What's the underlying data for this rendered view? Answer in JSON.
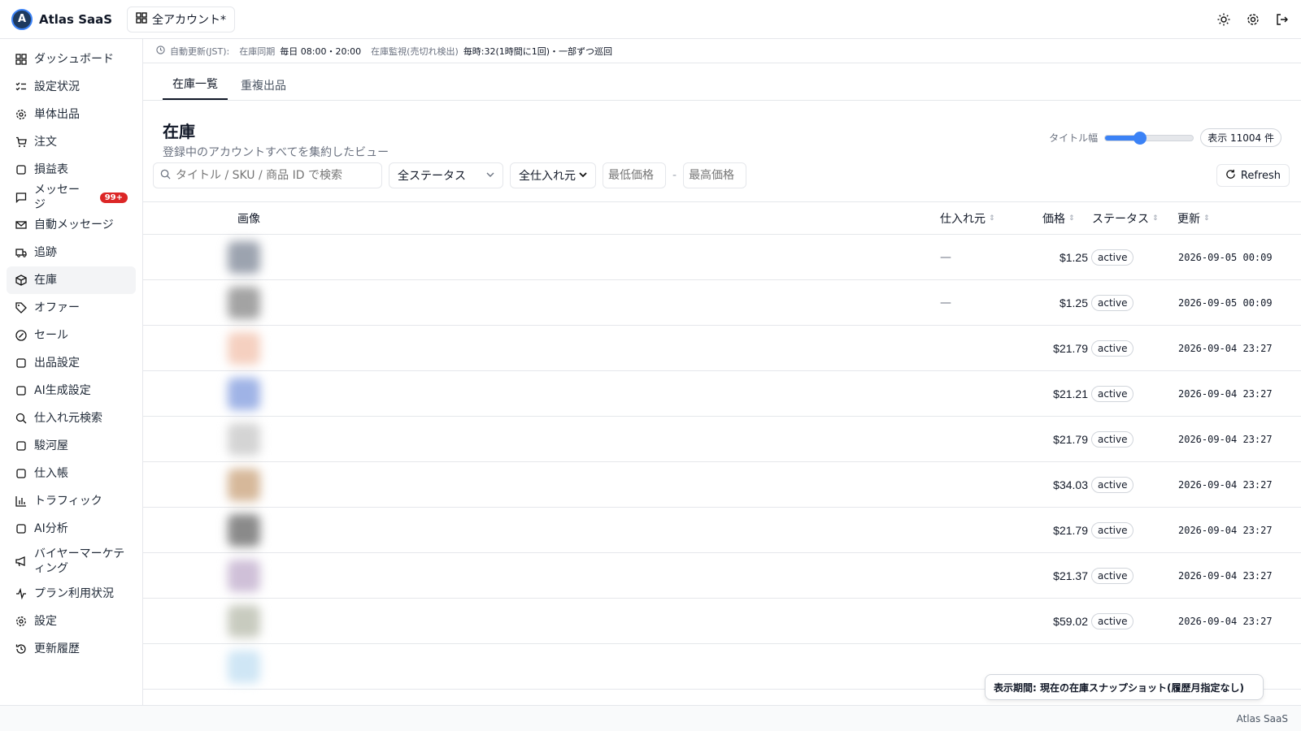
{
  "header": {
    "brand": "Atlas SaaS",
    "logo_letter": "A",
    "account_label": "全アカウント*"
  },
  "sidebar": {
    "items": [
      {
        "label": "ダッシュボード",
        "icon": "dashboard-icon"
      },
      {
        "label": "設定状況",
        "icon": "checklist-icon"
      },
      {
        "label": "単体出品",
        "icon": "gear-icon"
      },
      {
        "label": "注文",
        "icon": "cart-icon"
      },
      {
        "label": "損益表",
        "icon": "report-icon"
      },
      {
        "label": "メッセージ",
        "icon": "message-icon",
        "badge": "99+"
      },
      {
        "label": "自動メッセージ",
        "icon": "mail-icon"
      },
      {
        "label": "追跡",
        "icon": "truck-icon"
      },
      {
        "label": "在庫",
        "icon": "box-icon",
        "active": true
      },
      {
        "label": "オファー",
        "icon": "tag-icon"
      },
      {
        "label": "セール",
        "icon": "percent-icon"
      },
      {
        "label": "出品設定",
        "icon": "calculator-icon"
      },
      {
        "label": "AI生成設定",
        "icon": "robot-icon"
      },
      {
        "label": "仕入れ元検索",
        "icon": "search-icon"
      },
      {
        "label": "駿河屋",
        "icon": "bag-icon"
      },
      {
        "label": "仕入帳",
        "icon": "clipboard-icon"
      },
      {
        "label": "トラフィック",
        "icon": "bar-chart-icon"
      },
      {
        "label": "AI分析",
        "icon": "brain-icon"
      },
      {
        "label": "バイヤーマーケティング",
        "icon": "megaphone-icon"
      },
      {
        "label": "プラン利用状況",
        "icon": "activity-icon"
      },
      {
        "label": "設定",
        "icon": "settings-icon"
      },
      {
        "label": "更新履歴",
        "icon": "history-icon"
      }
    ]
  },
  "infobar": {
    "auto_label": "自動更新(JST):",
    "sync_label": "在庫同期",
    "sync_value": "毎日 08:00・20:00",
    "watch_label": "在庫監視(売切れ検出)",
    "watch_value": "毎時:32(1時間に1回)・一部ずつ巡回"
  },
  "tabs": [
    "在庫一覧",
    "重複出品"
  ],
  "page": {
    "title": "在庫",
    "subtitle": "登録中のアカウントすべてを集約したビュー",
    "title_width_label": "タイトル幅",
    "title_width_value": 0.4,
    "count_label": "表示 11004 件"
  },
  "filters": {
    "search_placeholder": "タイトル / SKU / 商品 ID で検索",
    "status_value": "全ステータス",
    "source_value": "全仕入れ元",
    "min_price_placeholder": "最低価格",
    "max_price_placeholder": "最高価格",
    "range_separator": "-",
    "refresh_label": "Refresh"
  },
  "table": {
    "columns": [
      "画像",
      "仕入れ元",
      "価格",
      "ステータス",
      "更新"
    ],
    "rows": [
      {
        "source": "—",
        "price": "$1.25",
        "status": "active",
        "updated": "2026-09-05 00:09",
        "thumb": "#9ca3af"
      },
      {
        "source": "—",
        "price": "$1.25",
        "status": "active",
        "updated": "2026-09-05 00:09",
        "thumb": "#a3a3a3"
      },
      {
        "source": "",
        "price": "$21.79",
        "status": "active",
        "updated": "2026-09-04 23:27",
        "thumb": "#f5d0c0"
      },
      {
        "source": "",
        "price": "$21.21",
        "status": "active",
        "updated": "2026-09-04 23:27",
        "thumb": "#9fb3e6"
      },
      {
        "source": "",
        "price": "$21.79",
        "status": "active",
        "updated": "2026-09-04 23:27",
        "thumb": "#d4d4d4"
      },
      {
        "source": "",
        "price": "$34.03",
        "status": "active",
        "updated": "2026-09-04 23:27",
        "thumb": "#d6b89a"
      },
      {
        "source": "",
        "price": "$21.79",
        "status": "active",
        "updated": "2026-09-04 23:27",
        "thumb": "#8a8a8a"
      },
      {
        "source": "",
        "price": "$21.37",
        "status": "active",
        "updated": "2026-09-04 23:27",
        "thumb": "#cfc0d8"
      },
      {
        "source": "",
        "price": "$59.02",
        "status": "active",
        "updated": "2026-09-04 23:27",
        "thumb": "#c8cbbf"
      },
      {
        "source": "",
        "price": "",
        "status": "",
        "updated": "",
        "thumb": "#cfe6f5"
      }
    ]
  },
  "toast": {
    "text": "表示期間: 現在の在庫スナップショット(履歴月指定なし)"
  },
  "footer": {
    "text": "Atlas SaaS"
  }
}
